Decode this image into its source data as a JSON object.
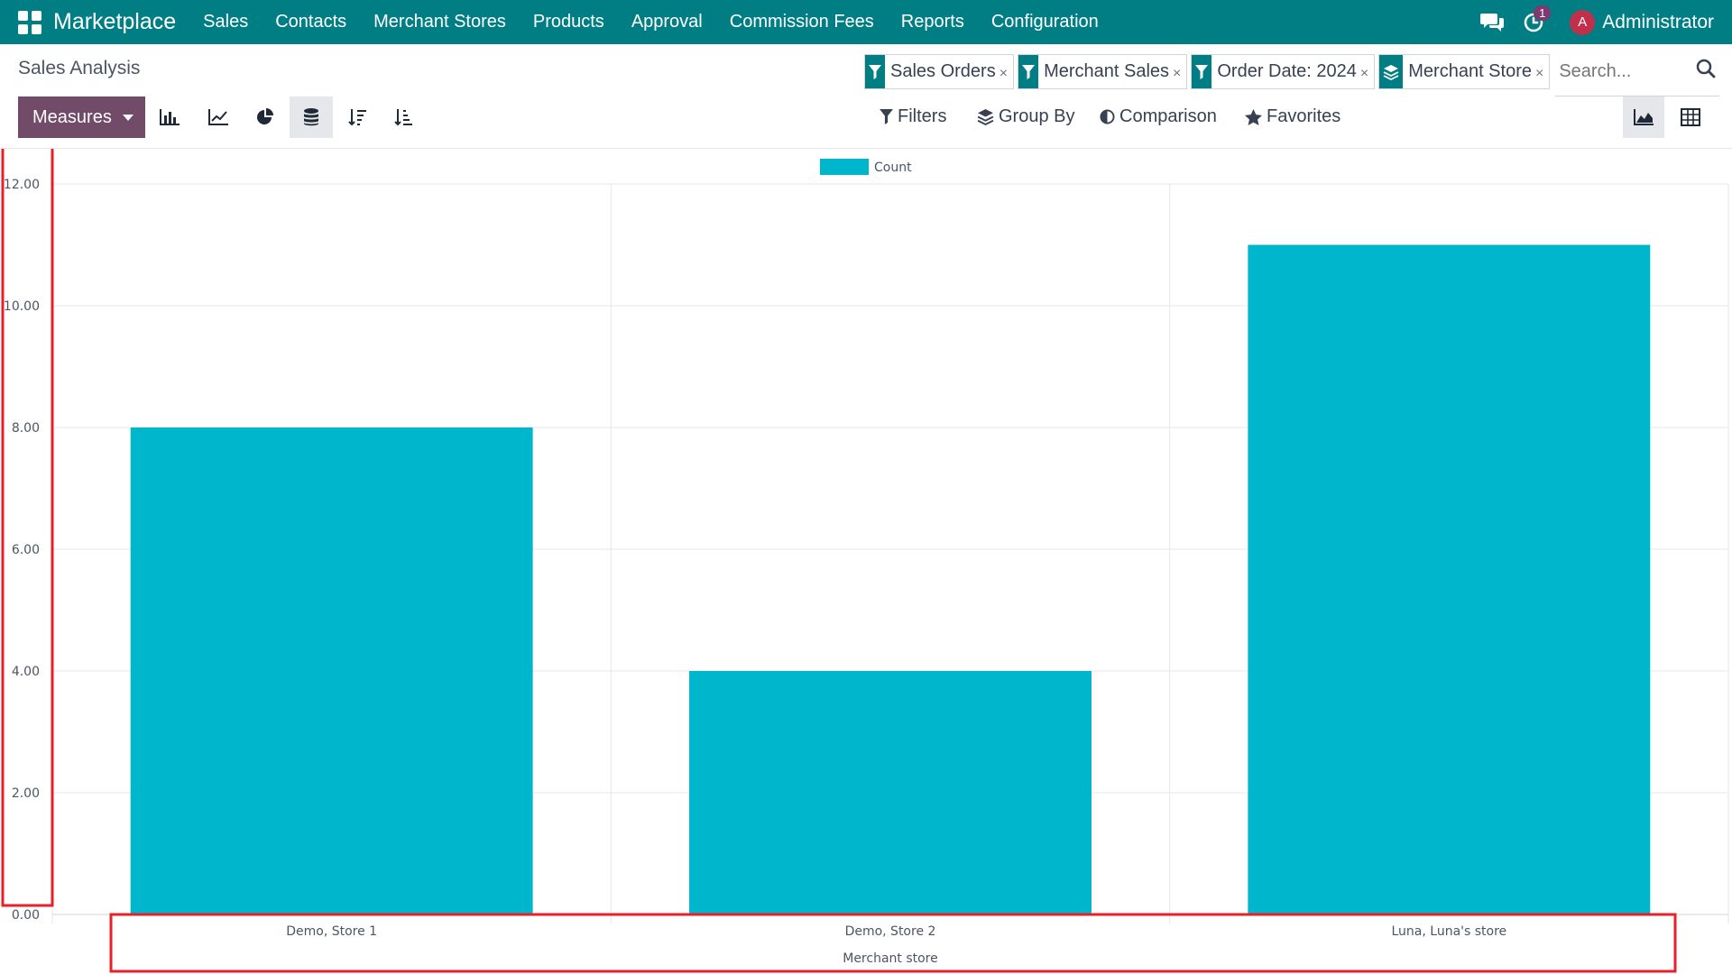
{
  "navbar": {
    "brand": "Marketplace",
    "menu": [
      "Sales",
      "Contacts",
      "Merchant Stores",
      "Products",
      "Approval",
      "Commission Fees",
      "Reports",
      "Configuration"
    ],
    "activity_badge": "1",
    "avatar_letter": "A",
    "user_name": "Administrator",
    "color": "#017e84"
  },
  "control_panel": {
    "title": "Sales Analysis",
    "facets": [
      {
        "icon": "filter-icon",
        "label": "Sales Orders"
      },
      {
        "icon": "filter-icon",
        "label": "Merchant Sales"
      },
      {
        "icon": "filter-icon",
        "label": "Order Date: 2024"
      },
      {
        "icon": "group-by-icon",
        "label": "Merchant Store"
      }
    ],
    "facet_remove": "×",
    "search_placeholder": "Search...",
    "measures_label": "Measures",
    "measures_color": "#714b67",
    "filters_label": "Filters",
    "group_by_label": "Group By",
    "comparison_label": "Comparison",
    "favorites_label": "Favorites"
  },
  "chart_data": {
    "type": "bar",
    "categories": [
      "Demo, Store 1",
      "Demo, Store 2",
      "Luna, Luna's store"
    ],
    "series": [
      {
        "name": "Count",
        "values": [
          8,
          4,
          11
        ],
        "color": "#00b6cc"
      }
    ],
    "xlabel": "Merchant store",
    "ylabel": "",
    "ylim": [
      0,
      12
    ],
    "yticks": [
      "0.00",
      "2.00",
      "4.00",
      "6.00",
      "8.00",
      "10.00",
      "12.00"
    ],
    "grid": true,
    "legend": "top-center"
  }
}
